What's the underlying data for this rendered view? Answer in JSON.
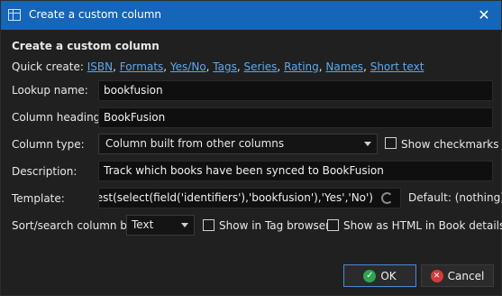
{
  "window": {
    "title": "Create a custom column",
    "close_glyph": "✕"
  },
  "heading": "Create a custom column",
  "quick_create": {
    "label": "Quick create:",
    "links": [
      "ISBN",
      "Formats",
      "Yes/No",
      "Tags",
      "Series",
      "Rating",
      "Names",
      "Short text"
    ]
  },
  "lookup": {
    "label": "Lookup name:",
    "value": "bookfusion"
  },
  "heading_field": {
    "label": "Column heading:",
    "value": "BookFusion"
  },
  "column_type": {
    "label": "Column type:",
    "value": "Column built from other columns"
  },
  "show_checkmarks": {
    "label": "Show checkmarks",
    "checked": false
  },
  "description": {
    "label": "Description:",
    "value": "Track which books have been synced to BookFusion"
  },
  "template": {
    "label": "Template:",
    "value": "program: test(select(field('identifiers'),'bookfusion'),'Yes','No')",
    "default_label": "Default: (nothing)"
  },
  "sort": {
    "label": "Sort/search column by",
    "value": "Text"
  },
  "show_in_tag_browser": {
    "label": "Show in Tag browser",
    "checked": false
  },
  "show_as_html": {
    "label": "Show as HTML in Book details",
    "checked": false
  },
  "buttons": {
    "ok": "OK",
    "cancel": "Cancel"
  },
  "colors": {
    "titlebar": "#1565b8",
    "link": "#5fa8e8",
    "ok_icon": "#2ea44f",
    "cancel_icon": "#d43b3b"
  }
}
